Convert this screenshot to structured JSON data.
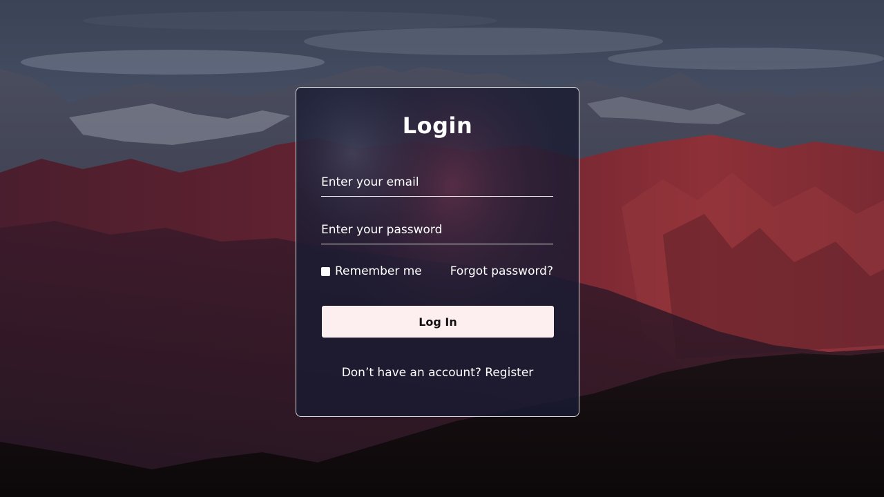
{
  "form": {
    "title": "Login",
    "email_placeholder": "Enter your email",
    "password_placeholder": "Enter your password",
    "remember_label": "Remember me",
    "forgot_label": "Forgot password?",
    "login_label": "Log In",
    "register_prompt": "Don’t have an account?",
    "register_label": "Register"
  },
  "colors": {
    "button_bg": "#fdeef0",
    "text": "#ffffff"
  }
}
